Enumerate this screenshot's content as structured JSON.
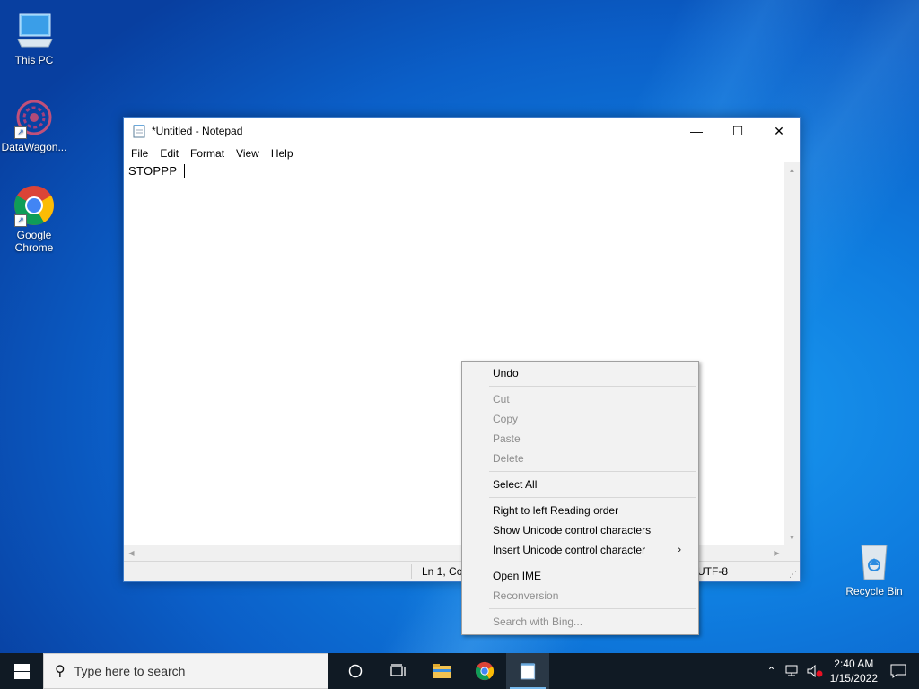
{
  "desktop": {
    "icons": [
      {
        "label": "This PC"
      },
      {
        "label": "DataWagon..."
      },
      {
        "label": "Google Chrome"
      },
      {
        "label": "Recycle Bin"
      }
    ]
  },
  "window": {
    "title": "*Untitled - Notepad",
    "menu": [
      "File",
      "Edit",
      "Format",
      "View",
      "Help"
    ],
    "content": "STOPPP",
    "status": {
      "position": "Ln 1, Co",
      "encoding": "UTF-8"
    }
  },
  "context_menu": {
    "items": [
      {
        "label": "Undo",
        "enabled": true
      },
      {
        "label": "Cut",
        "enabled": false
      },
      {
        "label": "Copy",
        "enabled": false
      },
      {
        "label": "Paste",
        "enabled": false
      },
      {
        "label": "Delete",
        "enabled": false
      },
      {
        "label": "Select All",
        "enabled": true
      },
      {
        "label": "Right to left Reading order",
        "enabled": true
      },
      {
        "label": "Show Unicode control characters",
        "enabled": true
      },
      {
        "label": "Insert Unicode control character",
        "enabled": true,
        "submenu": true
      },
      {
        "label": "Open IME",
        "enabled": true
      },
      {
        "label": "Reconversion",
        "enabled": false
      },
      {
        "label": "Search with Bing...",
        "enabled": false
      }
    ]
  },
  "taskbar": {
    "search_placeholder": "Type here to search",
    "time": "2:40 AM",
    "date": "1/15/2022"
  },
  "colors": {
    "accent": "#0f7ee0",
    "taskbar": "#101a24",
    "menu_bg": "#f2f2f2",
    "disabled_text": "#8e8e8e"
  }
}
